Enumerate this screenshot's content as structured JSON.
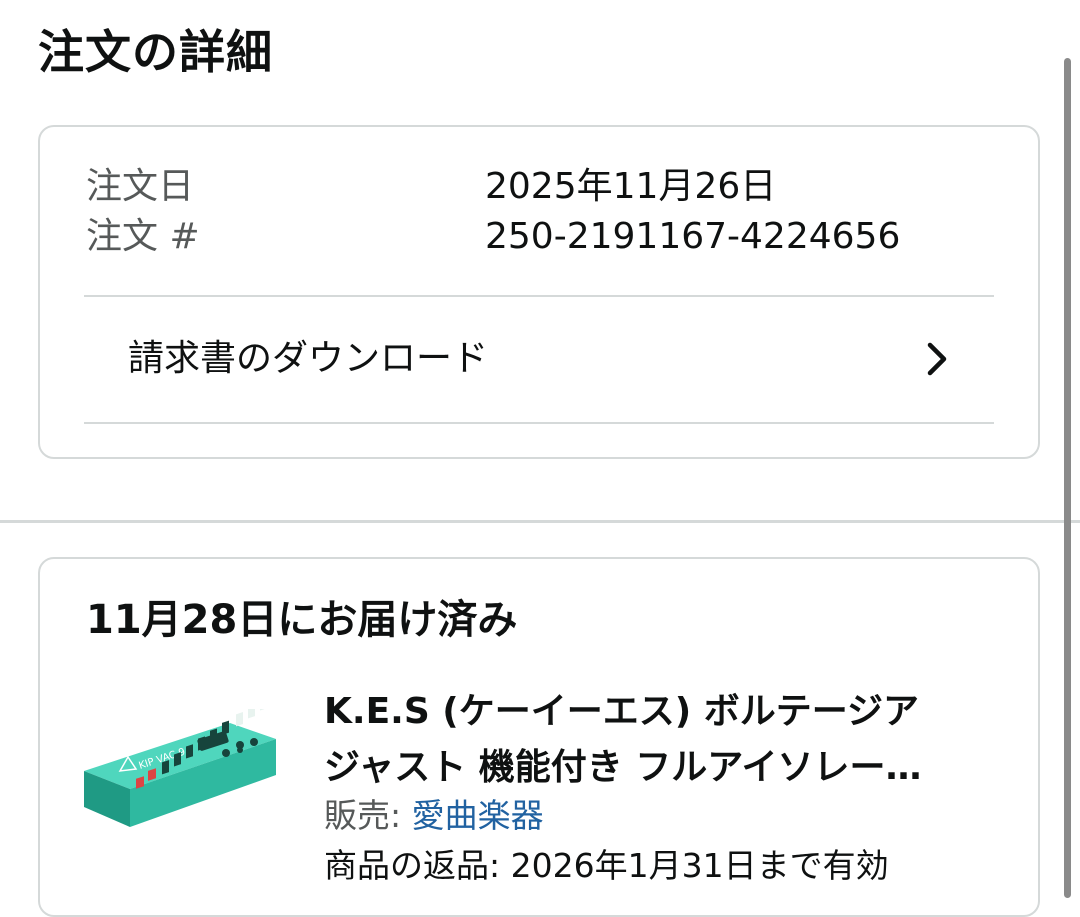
{
  "page_title": "注文の詳細",
  "order": {
    "date_label": "注文日",
    "date_value": "2025年11月26日",
    "number_label": "注文 #",
    "number_value": "250-2191167-4224656",
    "invoice_label": "請求書のダウンロード"
  },
  "delivery": {
    "status": "11月28日にお届け済み",
    "product": {
      "title_line1": "K.E.S (ケーイーエス) ボルテージア",
      "title_line2": "ジャスト 機能付き フルアイソレー…",
      "seller_label": "販売: ",
      "seller_name": "愛曲楽器",
      "return_text": "商品の返品: 2026年1月31日まで有効",
      "image_icon": "product-image"
    }
  },
  "colors": {
    "text": "#0f1111",
    "muted": "#565959",
    "link": "#2162a1",
    "border": "#d5d9d9",
    "product_teal": "#2fb9a0"
  }
}
